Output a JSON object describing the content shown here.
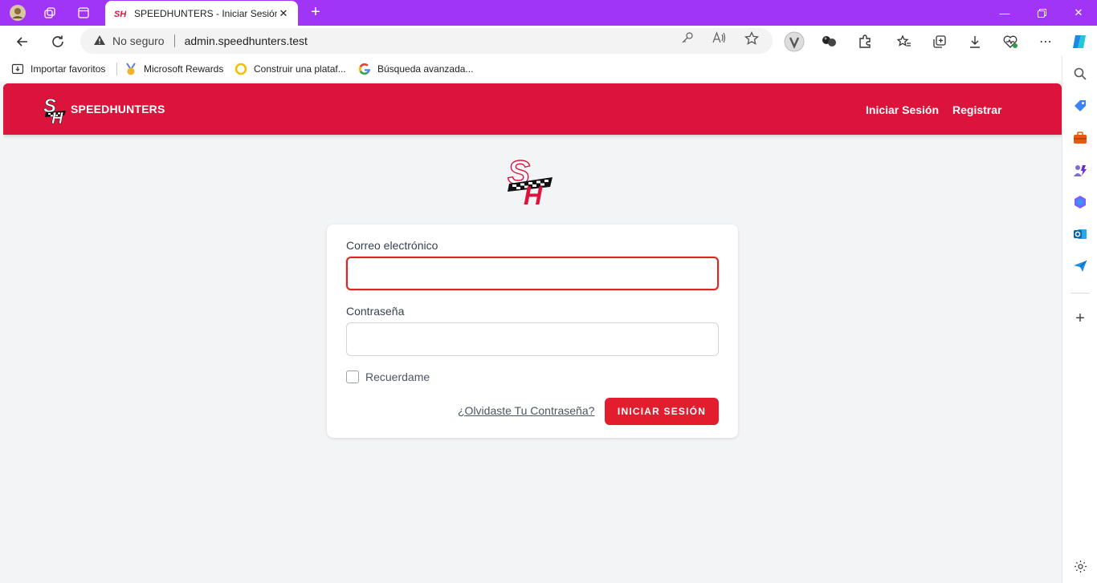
{
  "browser": {
    "tab_title": "SPEEDHUNTERS - Iniciar Sesión",
    "security_label": "No seguro",
    "url": "admin.speedhunters.test",
    "bookmarks": [
      {
        "label": "Importar favoritos",
        "icon": "folder-import-icon"
      },
      {
        "label": "Microsoft Rewards",
        "icon": "rewards-medal-icon"
      },
      {
        "label": "Construir una plataf...",
        "icon": "ring-icon"
      },
      {
        "label": "Búsqueda avanzada...",
        "icon": "google-icon"
      }
    ],
    "accent_color": "#a035f7"
  },
  "site": {
    "brand": "SPEEDHUNTERS",
    "logo_text": "SH",
    "nav": {
      "login": "Iniciar Sesión",
      "register": "Registrar"
    },
    "primary_color": "#dc143c"
  },
  "form": {
    "email_label": "Correo electrónico",
    "email_value": "",
    "password_label": "Contraseña",
    "password_value": "",
    "remember_label": "Recuerdame",
    "forgot_link": "¿Olvidaste Tu Contraseña?",
    "submit_label": "INICIAR SESIÓN"
  }
}
